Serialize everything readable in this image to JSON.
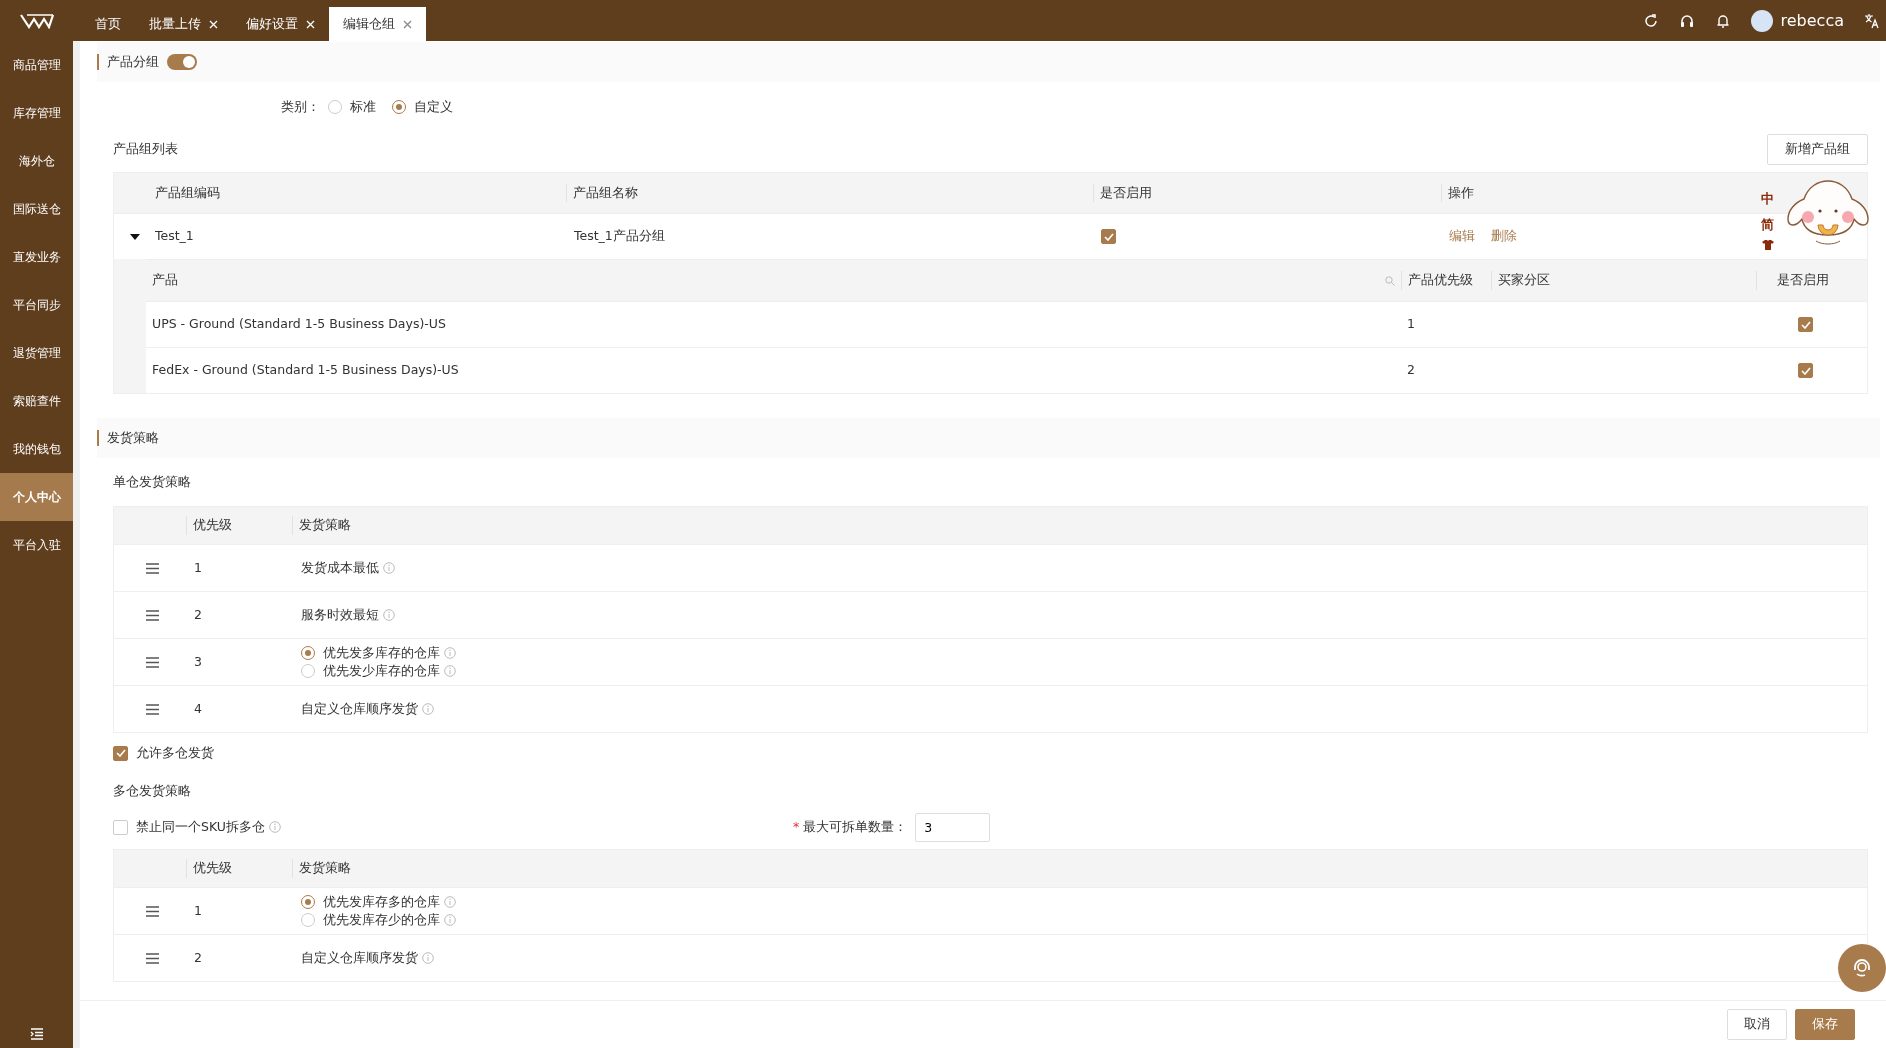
{
  "top_bar": {
    "tabs": [
      {
        "label": "首页",
        "closable": false,
        "selected": false
      },
      {
        "label": "批量上传",
        "closable": true,
        "selected": false
      },
      {
        "label": "偏好设置",
        "closable": true,
        "selected": false
      },
      {
        "label": "编辑仓组",
        "closable": true,
        "selected": true
      }
    ],
    "user": {
      "name": "rebecca"
    }
  },
  "sidebar": {
    "items": [
      {
        "label": "商品管理",
        "selected": false
      },
      {
        "label": "库存管理",
        "selected": false
      },
      {
        "label": "海外仓",
        "selected": false
      },
      {
        "label": "国际送仓",
        "selected": false
      },
      {
        "label": "直发业务",
        "selected": false
      },
      {
        "label": "平台同步",
        "selected": false
      },
      {
        "label": "退货管理",
        "selected": false
      },
      {
        "label": "索赔查件",
        "selected": false
      },
      {
        "label": "我的钱包",
        "selected": false
      },
      {
        "label": "个人中心",
        "selected": true
      },
      {
        "label": "平台入驻",
        "selected": false
      }
    ]
  },
  "product_group": {
    "title": "产品分组",
    "enabled": true,
    "category_label": "类别：",
    "category_options": [
      {
        "label": "标准",
        "selected": false
      },
      {
        "label": "自定义",
        "selected": true
      }
    ],
    "list_title": "产品组列表",
    "add_button": "新增产品组",
    "columns": [
      "产品组编码",
      "产品组名称",
      "是否启用",
      "操作"
    ],
    "rows": [
      {
        "code": "Test_1",
        "name": "Test_1产品分组",
        "enabled": true,
        "expanded": true,
        "actions": [
          "编辑",
          "删除"
        ],
        "sub_columns": [
          "产品",
          "产品优先级",
          "买家分区",
          "是否启用"
        ],
        "products": [
          {
            "product": "UPS - Ground (Standard 1-5 Business Days)-US",
            "priority": "1",
            "enabled": true
          },
          {
            "product": "FedEx - Ground (Standard 1-5 Business Days)-US",
            "priority": "2",
            "enabled": true
          }
        ]
      }
    ]
  },
  "shipping_strategy": {
    "title": "发货策略",
    "single_title": "单仓发货策略",
    "single_columns": [
      "优先级",
      "发货策略"
    ],
    "single_rows": [
      {
        "priority": "1",
        "kind": "text",
        "text": "发货成本最低"
      },
      {
        "priority": "2",
        "kind": "text",
        "text": "服务时效最短"
      },
      {
        "priority": "3",
        "kind": "radio",
        "options": [
          {
            "label": "优先发多库存的仓库",
            "selected": true
          },
          {
            "label": "优先发少库存的仓库",
            "selected": false
          }
        ]
      },
      {
        "priority": "4",
        "kind": "text",
        "text": "自定义仓库顺序发货"
      }
    ],
    "allow_multi": {
      "label": "允许多仓发货",
      "checked": true
    },
    "multi_title": "多仓发货策略",
    "no_split_sku": {
      "label": "禁止同一个SKU拆多仓",
      "checked": false
    },
    "max_split": {
      "label": "最大可拆单数量：",
      "required_mark": "*",
      "value": "3"
    },
    "multi_columns": [
      "优先级",
      "发货策略"
    ],
    "multi_rows": [
      {
        "priority": "1",
        "kind": "radio",
        "options": [
          {
            "label": "优先发库存多的仓库",
            "selected": true
          },
          {
            "label": "优先发库存少的仓库",
            "selected": false
          }
        ]
      },
      {
        "priority": "2",
        "kind": "text",
        "text": "自定义仓库顺序发货"
      }
    ]
  },
  "floating_widget": {
    "lines": [
      "中",
      "简"
    ]
  },
  "footer_buttons": [
    {
      "label": "取消",
      "kind": "default"
    },
    {
      "label": "保存",
      "kind": "primary"
    }
  ]
}
